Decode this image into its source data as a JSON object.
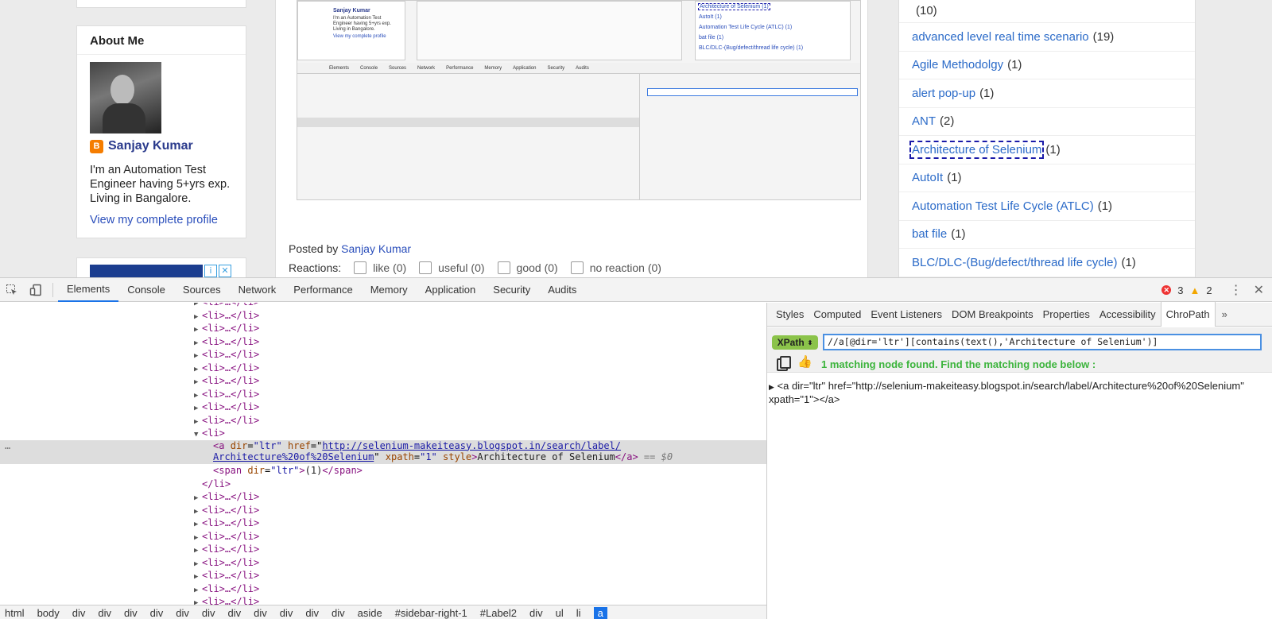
{
  "page": {
    "about": {
      "heading": "About Me",
      "author": "Sanjay Kumar",
      "bio": "I'm an Automation Test Engineer having 5+yrs exp. Living in Bangalore.",
      "profile_link": "View my complete profile"
    },
    "post": {
      "posted_by_prefix": "Posted by",
      "posted_by_author": "Sanjay Kumar",
      "reactions_label": "Reactions:",
      "reactions": [
        "like (0)",
        "useful (0)",
        "good (0)",
        "no reaction (0)"
      ],
      "embedded": {
        "author": "Sanjay Kumar",
        "bio": "I'm an Automation Test Engineer having 5+yrs exp. Living in Bangalore.",
        "profile_link": "View my complete profile",
        "labels": [
          "Architecture of Selenium (1)",
          "AutoIt (1)",
          "Automation Test Life Cycle (ATLC) (1)",
          "bat file (1)",
          "BLC/DLC-(Bug/defect/thread life cycle) (1)"
        ],
        "tabs": [
          "Elements",
          "Console",
          "Sources",
          "Network",
          "Performance",
          "Memory",
          "Application",
          "Security",
          "Audits"
        ]
      }
    },
    "labels": [
      {
        "name": "",
        "count": "(10)"
      },
      {
        "name": "advanced level real time scenario",
        "count": "(19)"
      },
      {
        "name": "Agile Methodolgy",
        "count": "(1)"
      },
      {
        "name": "alert pop-up",
        "count": "(1)"
      },
      {
        "name": "ANT",
        "count": "(2)"
      },
      {
        "name": "Architecture of Selenium",
        "count": "(1)",
        "focused": true
      },
      {
        "name": "AutoIt",
        "count": "(1)"
      },
      {
        "name": "Automation Test Life Cycle (ATLC)",
        "count": "(1)"
      },
      {
        "name": "bat file",
        "count": "(1)"
      },
      {
        "name": "BLC/DLC-(Bug/defect/thread life cycle)",
        "count": "(1)"
      }
    ]
  },
  "devtools": {
    "tabs": [
      "Elements",
      "Console",
      "Sources",
      "Network",
      "Performance",
      "Memory",
      "Application",
      "Security",
      "Audits"
    ],
    "active_tab": "Elements",
    "errors": "3",
    "warnings": "2",
    "dom": {
      "collapsed_li": "<li>…</li>",
      "open_li": "<li>",
      "close_li": "</li>",
      "a_tag_open": "<a",
      "a_attr_dir": "dir",
      "a_val_dir": "\"ltr\"",
      "a_attr_href": "href",
      "a_val_href_1": "http://selenium-makeiteasy.blogspot.in/search/label/",
      "a_val_href_2": "Architecture%20of%20Selenium",
      "a_attr_xpath": "xpath",
      "a_val_xpath": "\"1\"",
      "a_attr_style": "style",
      "a_text": "Architecture of Selenium",
      "a_close": "</a>",
      "dollar": "== $0",
      "span_open": "<span",
      "span_attr": "dir",
      "span_val": "\"ltr\"",
      "span_text": "(1)",
      "span_close": "</span>"
    },
    "breadcrumbs": [
      "html",
      "body",
      "div",
      "div",
      "div",
      "div",
      "div",
      "div",
      "div",
      "div",
      "div",
      "div",
      "div",
      "aside",
      "#sidebar-right-1",
      "#Label2",
      "div",
      "ul",
      "li",
      "a"
    ],
    "sidebar_tabs": [
      "Styles",
      "Computed",
      "Event Listeners",
      "DOM Breakpoints",
      "Properties",
      "Accessibility",
      "ChroPath"
    ],
    "active_sidebar_tab": "ChroPath",
    "chropath": {
      "selector_type": "XPath",
      "xpath": "//a[@dir='ltr'][contains(text(),'Architecture of Selenium')]",
      "match_message": "1 matching node found. Find the matching node below :",
      "result": "<a dir=\"ltr\" href=\"http://selenium-makeiteasy.blogspot.in/search/label/Architecture%20of%20Selenium\" xpath=\"1\"></a>"
    }
  },
  "colors": {
    "accent": "#1a73e8",
    "link": "#2a6ac8",
    "match_green": "#3cb43c",
    "xpath_badge": "#8bc34a",
    "error_red": "#e33333",
    "warning_amber": "#f2a600"
  }
}
